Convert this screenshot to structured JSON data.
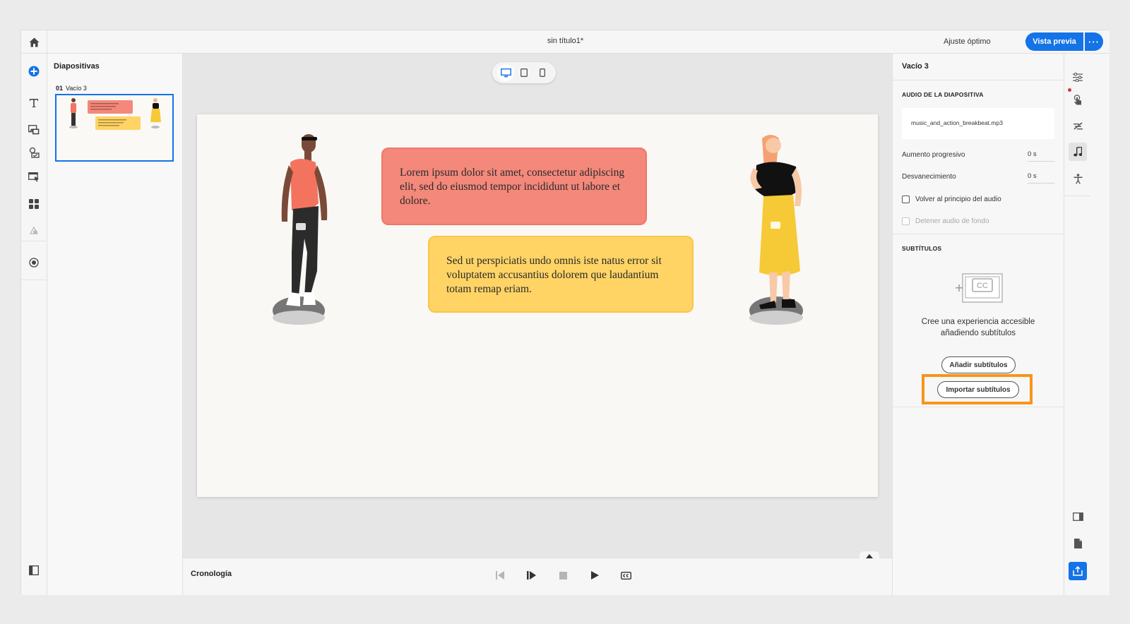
{
  "topbar": {
    "doc_title": "sin título1*",
    "zoom_value": "Ajuste óptimo",
    "preview_label": "Vista previa",
    "more_label": "···"
  },
  "slides_panel": {
    "title": "Diapositivas",
    "slides": [
      {
        "number": "01",
        "name": "Vacío 3"
      }
    ]
  },
  "slide": {
    "bubble_1": "Lorem ipsum dolor sit amet, consectetur adipiscing elit, sed do eiusmod tempor incididunt ut labore et dolore.",
    "bubble_2": "Sed ut perspiciatis undo omnis iste natus error sit voluptatem accusantius dolorem que laudantium totam remap eriam."
  },
  "timeline": {
    "label": "Cronología"
  },
  "properties": {
    "title": "Vacío 3",
    "audio_section": "AUDIO DE LA DIAPOSITIVA",
    "audio_file": "music_and_action_breakbeat.mp3",
    "fade_in_label": "Aumento progresivo",
    "fade_in_value": "0 s",
    "fade_out_label": "Desvanecimiento",
    "fade_out_value": "0 s",
    "rewind_label": "Volver al principio del audio",
    "stop_bg_label": "Detener audio de fondo",
    "captions_section": "SUBTÍTULOS",
    "captions_message_line1": "Cree una experiencia accesible",
    "captions_message_line2": "añadiendo subtítulos",
    "cc_glyph": "CC",
    "add_captions_label": "Añadir subtítulos",
    "import_captions_label": "Importar subtítulos"
  },
  "colors": {
    "accent": "#1473e6",
    "highlight": "#f7941d",
    "bubble_red": "#f4887a",
    "bubble_yellow": "#ffd465"
  }
}
